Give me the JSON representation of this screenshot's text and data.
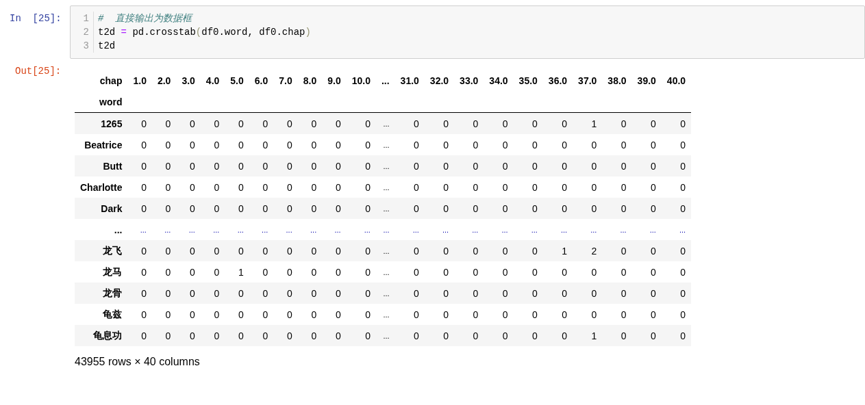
{
  "input_cell": {
    "prompt": "In  [25]:",
    "lines": [
      {
        "number": "1",
        "segments": [
          {
            "kind": "comment",
            "text": "#  直接输出为数据框"
          }
        ]
      },
      {
        "number": "2",
        "segments": [
          {
            "kind": "plain",
            "text": "t2d "
          },
          {
            "kind": "operator",
            "text": "="
          },
          {
            "kind": "plain",
            "text": " pd.crosstab"
          },
          {
            "kind": "paren",
            "text": "("
          },
          {
            "kind": "plain",
            "text": "df0.word, df0.chap"
          },
          {
            "kind": "paren",
            "text": ")"
          }
        ]
      },
      {
        "number": "3",
        "segments": [
          {
            "kind": "plain",
            "text": "t2d"
          }
        ]
      }
    ]
  },
  "output_cell": {
    "prompt": "Out[25]:",
    "table": {
      "columns_name": "chap",
      "index_name": "word",
      "columns": [
        "1.0",
        "2.0",
        "3.0",
        "4.0",
        "5.0",
        "6.0",
        "7.0",
        "8.0",
        "9.0",
        "10.0",
        "...",
        "31.0",
        "32.0",
        "33.0",
        "34.0",
        "35.0",
        "36.0",
        "37.0",
        "38.0",
        "39.0",
        "40.0"
      ],
      "rows": [
        {
          "kind": "data",
          "index": "1265",
          "cells": [
            "0",
            "0",
            "0",
            "0",
            "0",
            "0",
            "0",
            "0",
            "0",
            "0",
            "...",
            "0",
            "0",
            "0",
            "0",
            "0",
            "0",
            "1",
            "0",
            "0",
            "0"
          ]
        },
        {
          "kind": "data",
          "index": "Beatrice",
          "cells": [
            "0",
            "0",
            "0",
            "0",
            "0",
            "0",
            "0",
            "0",
            "0",
            "0",
            "...",
            "0",
            "0",
            "0",
            "0",
            "0",
            "0",
            "0",
            "0",
            "0",
            "0"
          ]
        },
        {
          "kind": "data",
          "index": "Butt",
          "cells": [
            "0",
            "0",
            "0",
            "0",
            "0",
            "0",
            "0",
            "0",
            "0",
            "0",
            "...",
            "0",
            "0",
            "0",
            "0",
            "0",
            "0",
            "0",
            "0",
            "0",
            "0"
          ]
        },
        {
          "kind": "data",
          "index": "Charlotte",
          "cells": [
            "0",
            "0",
            "0",
            "0",
            "0",
            "0",
            "0",
            "0",
            "0",
            "0",
            "...",
            "0",
            "0",
            "0",
            "0",
            "0",
            "0",
            "0",
            "0",
            "0",
            "0"
          ]
        },
        {
          "kind": "data",
          "index": "Dark",
          "cells": [
            "0",
            "0",
            "0",
            "0",
            "0",
            "0",
            "0",
            "0",
            "0",
            "0",
            "...",
            "0",
            "0",
            "0",
            "0",
            "0",
            "0",
            "0",
            "0",
            "0",
            "0"
          ]
        },
        {
          "kind": "ellipsis",
          "index": "...",
          "cells": [
            "...",
            "...",
            "...",
            "...",
            "...",
            "...",
            "...",
            "...",
            "...",
            "...",
            "...",
            "...",
            "...",
            "...",
            "...",
            "...",
            "...",
            "...",
            "...",
            "...",
            "..."
          ]
        },
        {
          "kind": "data",
          "index": "龙飞",
          "cells": [
            "0",
            "0",
            "0",
            "0",
            "0",
            "0",
            "0",
            "0",
            "0",
            "0",
            "...",
            "0",
            "0",
            "0",
            "0",
            "0",
            "1",
            "2",
            "0",
            "0",
            "0"
          ]
        },
        {
          "kind": "data",
          "index": "龙马",
          "cells": [
            "0",
            "0",
            "0",
            "0",
            "1",
            "0",
            "0",
            "0",
            "0",
            "0",
            "...",
            "0",
            "0",
            "0",
            "0",
            "0",
            "0",
            "0",
            "0",
            "0",
            "0"
          ]
        },
        {
          "kind": "data",
          "index": "龙骨",
          "cells": [
            "0",
            "0",
            "0",
            "0",
            "0",
            "0",
            "0",
            "0",
            "0",
            "0",
            "...",
            "0",
            "0",
            "0",
            "0",
            "0",
            "0",
            "0",
            "0",
            "0",
            "0"
          ]
        },
        {
          "kind": "data",
          "index": "龟兹",
          "cells": [
            "0",
            "0",
            "0",
            "0",
            "0",
            "0",
            "0",
            "0",
            "0",
            "0",
            "...",
            "0",
            "0",
            "0",
            "0",
            "0",
            "0",
            "0",
            "0",
            "0",
            "0"
          ]
        },
        {
          "kind": "data",
          "index": "龟息功",
          "cells": [
            "0",
            "0",
            "0",
            "0",
            "0",
            "0",
            "0",
            "0",
            "0",
            "0",
            "...",
            "0",
            "0",
            "0",
            "0",
            "0",
            "0",
            "1",
            "0",
            "0",
            "0"
          ]
        }
      ],
      "shape": "43955 rows × 40 columns"
    }
  }
}
